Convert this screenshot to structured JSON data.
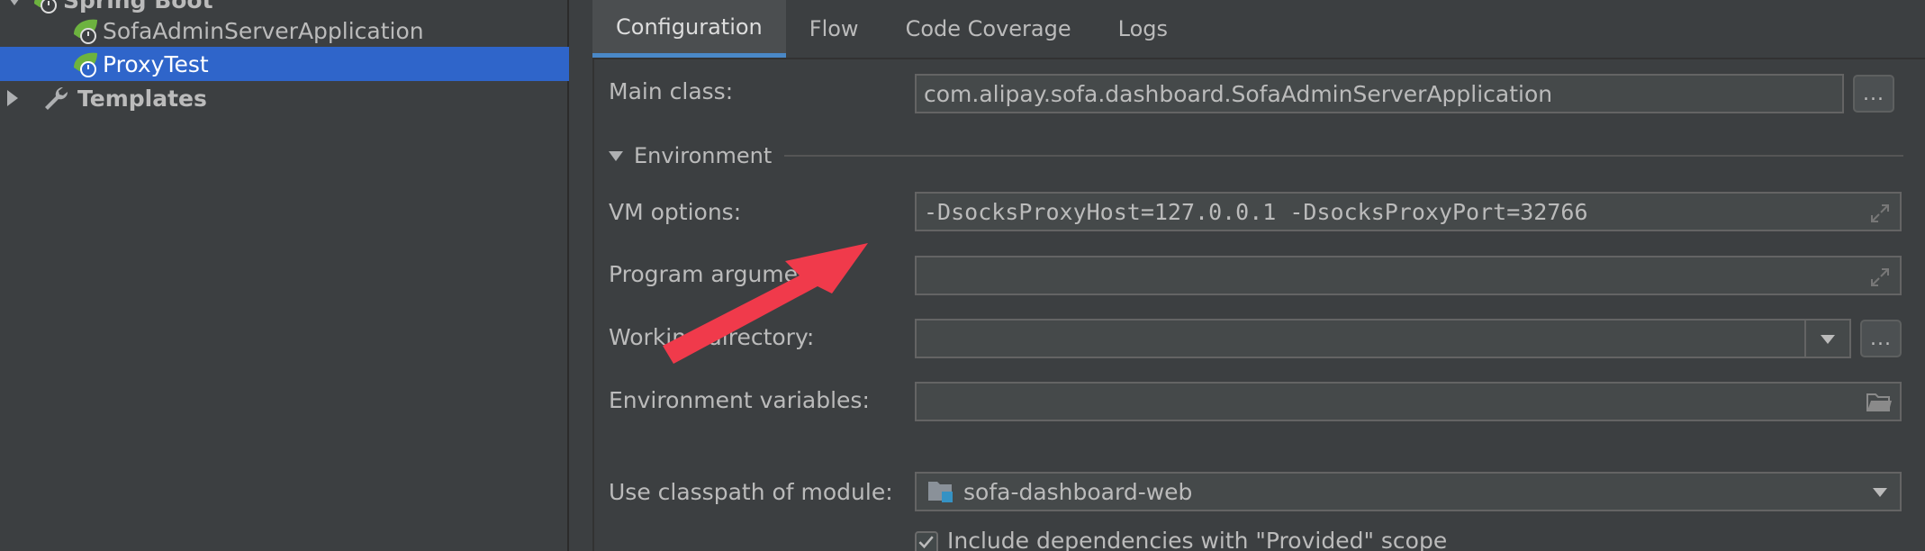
{
  "tree": {
    "items": [
      {
        "label": "Spring Boot",
        "icon": "spring-boot-icon",
        "expanded": true
      },
      {
        "label": "SofaAdminServerApplication",
        "icon": "spring-boot-icon"
      },
      {
        "label": "ProxyTest",
        "icon": "spring-boot-icon",
        "selected": true
      },
      {
        "label": "Templates",
        "icon": "wrench-icon",
        "expanded": false
      }
    ]
  },
  "tabs": [
    {
      "label": "Configuration",
      "active": true
    },
    {
      "label": "Flow"
    },
    {
      "label": "Code Coverage"
    },
    {
      "label": "Logs"
    }
  ],
  "form": {
    "main_class": {
      "label": "Main class:",
      "value": "com.alipay.sofa.dashboard.SofaAdminServerApplication",
      "button": "..."
    },
    "environment_section": "Environment",
    "vm_options": {
      "label": "VM options:",
      "value": "-DsocksProxyHost=127.0.0.1 -DsocksProxyPort=32766"
    },
    "program_arguments": {
      "label": "Program arguments:",
      "value": ""
    },
    "working_directory": {
      "label": "Working directory:",
      "value": "",
      "button": "..."
    },
    "environment_variables": {
      "label": "Environment variables:",
      "value": ""
    },
    "classpath_module": {
      "label": "Use classpath of module:",
      "value": "sofa-dashboard-web"
    },
    "include_dependencies": {
      "label": "Include dependencies with \"Provided\" scope",
      "checked": true
    }
  },
  "colors": {
    "background": "#3c3f41",
    "selection": "#2f65ca",
    "tab_active_underline": "#4a88c7",
    "annotation_arrow": "#f03a4b",
    "spring_green": "#6db33f"
  }
}
